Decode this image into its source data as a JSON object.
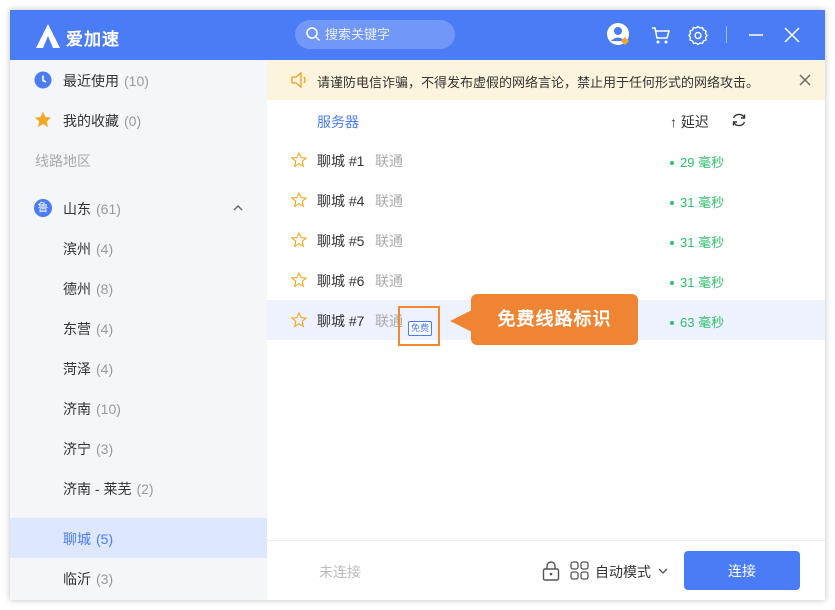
{
  "app": {
    "title": "爱加速",
    "brand_color": "#4a7cf6"
  },
  "search": {
    "placeholder": "搜索关键字"
  },
  "titlebar_icons": [
    "avatar-icon",
    "cart-icon",
    "gear-icon",
    "minimize-icon",
    "close-icon"
  ],
  "sidebar": {
    "recent": {
      "label": "最近使用",
      "count": "(10)"
    },
    "favorites": {
      "label": "我的收藏",
      "count": "(0)"
    },
    "section_label": "线路地区",
    "province": {
      "badge": "鲁",
      "label": "山东",
      "count": "(61)",
      "expanded": true
    },
    "cities": [
      {
        "label": "滨州",
        "count": "(4)"
      },
      {
        "label": "德州",
        "count": "(8)"
      },
      {
        "label": "东营",
        "count": "(4)"
      },
      {
        "label": "菏泽",
        "count": "(4)"
      },
      {
        "label": "济南",
        "count": "(10)"
      },
      {
        "label": "济宁",
        "count": "(3)"
      },
      {
        "label": "济南 - 莱芜",
        "count": "(2)"
      },
      {
        "label": "聊城",
        "count": "(5)",
        "selected": true
      },
      {
        "label": "临沂",
        "count": "(3)"
      }
    ]
  },
  "notice": {
    "text": "请谨防电信诈骗，不得发布虚假的网络言论，禁止用于任何形式的网络攻击。"
  },
  "list_header": {
    "server": "服务器",
    "latency": "↑ 延迟"
  },
  "servers": [
    {
      "name": "聊城 #1",
      "isp": "联通",
      "latency": "29 毫秒"
    },
    {
      "name": "聊城 #4",
      "isp": "联通",
      "latency": "31 毫秒"
    },
    {
      "name": "聊城 #5",
      "isp": "联通",
      "latency": "31 毫秒"
    },
    {
      "name": "聊城 #6",
      "isp": "联通",
      "latency": "31 毫秒"
    },
    {
      "name": "聊城 #7",
      "isp": "联通",
      "latency": "63 毫秒",
      "free_tag": "免费",
      "highlighted": true
    }
  ],
  "callout": {
    "text": "免费线路标识",
    "color": "#ef8432"
  },
  "bottom": {
    "status": "未连接",
    "mode": "自动模式",
    "connect_label": "连接"
  },
  "colors": {
    "latency_good": "#2fbf6a",
    "star": "#f5a623",
    "selected_bg": "#dde7fd",
    "notice_bg": "#fdf4dd"
  }
}
